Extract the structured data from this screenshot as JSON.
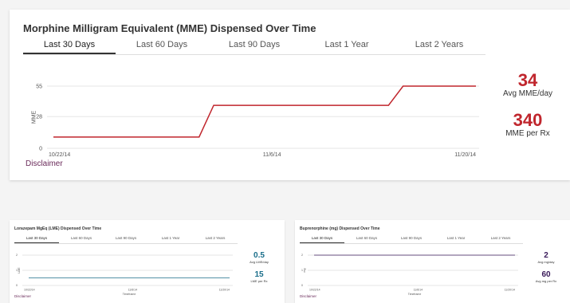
{
  "mme": {
    "title": "Morphine Milligram Equivalent (MME) Dispensed Over Time",
    "tabs": [
      "Last 30 Days",
      "Last 60 Days",
      "Last 90 Days",
      "Last 1 Year",
      "Last 2 Years"
    ],
    "active_tab": 0,
    "disclaimer": "Disclaimer",
    "stats": [
      {
        "value": "34",
        "label": "Avg MME/day"
      },
      {
        "value": "340",
        "label": "MME per Rx"
      }
    ],
    "accent": "#c0262d",
    "chart_data": {
      "type": "line",
      "x": [
        "10/22/14",
        "11/1/14",
        "11/2/14",
        "11/14/14",
        "11/15/14",
        "11/20/14"
      ],
      "series": [
        {
          "values": [
            10,
            10,
            38,
            38,
            55,
            55
          ]
        }
      ],
      "x_ticks": [
        "10/22/14",
        "11/6/14",
        "11/20/14"
      ],
      "y_ticks": [
        0,
        28,
        55
      ],
      "ylim": [
        0,
        55
      ],
      "xlabel": "Timeframe",
      "ylabel": "MME",
      "grid": true
    }
  },
  "lme": {
    "title": "Lorazepam MgEq (LME) Dispensed Over Time",
    "tabs": [
      "Last 30 Days",
      "Last 60 Days",
      "Last 90 Days",
      "Last 1 Year",
      "Last 2 Years"
    ],
    "active_tab": 0,
    "disclaimer": "Disclaimer",
    "stats": [
      {
        "value": "0.5",
        "label": "Avg LME/day"
      },
      {
        "value": "15",
        "label": "LME per Rx"
      }
    ],
    "accent": "#1a6e8a",
    "chart_data": {
      "type": "line",
      "x": [
        "10/22/14",
        "11/20/14"
      ],
      "series": [
        {
          "values": [
            0.5,
            0.5
          ]
        }
      ],
      "x_ticks": [
        "10/22/14",
        "11/6/14",
        "11/20/14"
      ],
      "y_ticks": [
        0,
        1,
        2
      ],
      "ylim": [
        0,
        2
      ],
      "xlabel": "Timeframe",
      "ylabel": "LME",
      "grid": true
    }
  },
  "bup": {
    "title": "Buprenorphine (mg) Dispensed Over Time",
    "tabs": [
      "Last 30 Days",
      "Last 60 Days",
      "Last 90 Days",
      "Last 1 Year",
      "Last 2 Years"
    ],
    "active_tab": 0,
    "disclaimer": "Disclaimer",
    "stats": [
      {
        "value": "2",
        "label": "Avg mg/day"
      },
      {
        "value": "60",
        "label": "Avg mg per Rx"
      }
    ],
    "accent": "#3a1a5a",
    "chart_data": {
      "type": "line",
      "x": [
        "10/22/14",
        "11/20/14"
      ],
      "series": [
        {
          "values": [
            2,
            2
          ]
        }
      ],
      "x_ticks": [
        "10/22/14",
        "11/6/14",
        "11/20/14"
      ],
      "y_ticks": [
        0,
        1,
        2
      ],
      "ylim": [
        0,
        2
      ],
      "xlabel": "Timeframe",
      "ylabel": "mg",
      "grid": true
    }
  }
}
